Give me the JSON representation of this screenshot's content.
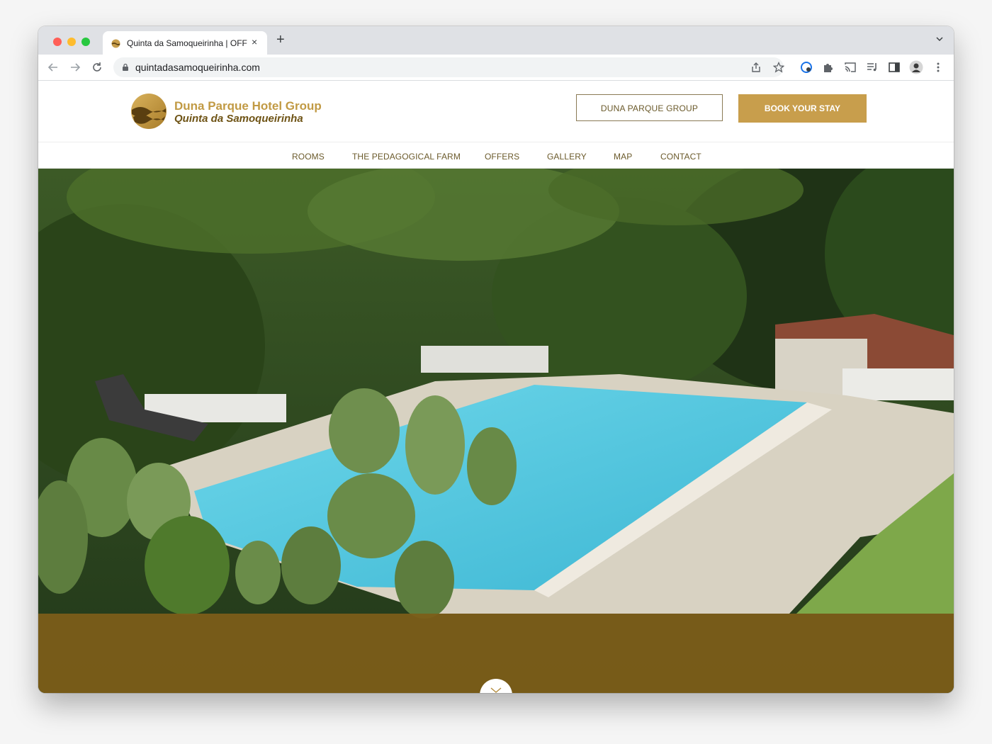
{
  "browser": {
    "tab_title": "Quinta da Samoqueirinha | OFF",
    "tab_close": "×",
    "new_tab": "+",
    "url": "quintadasamoqueirinha.com"
  },
  "site": {
    "logo_line1": "Duna Parque Hotel Group",
    "logo_line2": "Quinta da Samoqueirinha",
    "group_button": "DUNA PARQUE GROUP",
    "book_button": "BOOK YOUR STAY",
    "nav": [
      "ROOMS",
      "THE PEDAGOGICAL FARM",
      "OFFERS",
      "GALLERY",
      "MAP",
      "CONTACT"
    ]
  },
  "colors": {
    "brand_gold": "#c89e4c",
    "brand_brown": "#6e5315",
    "band": "#7e5e19"
  }
}
